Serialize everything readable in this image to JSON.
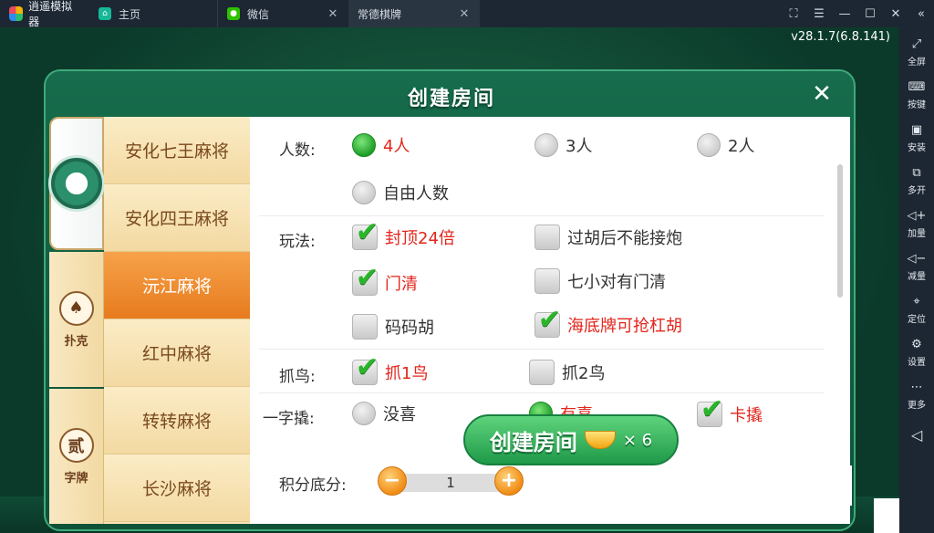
{
  "emulator": {
    "app_name": "逍遥模拟器",
    "tabs": [
      {
        "label": "主页"
      },
      {
        "label": "微信"
      },
      {
        "label": "常德棋牌"
      }
    ],
    "version": "v28.1.7(6.8.141)",
    "sidebar": [
      {
        "label": "全屏",
        "icon": "fullscreen-icon"
      },
      {
        "label": "按键",
        "icon": "keyboard-icon"
      },
      {
        "label": "安装",
        "icon": "apk-install-icon"
      },
      {
        "label": "多开",
        "icon": "multi-open-icon"
      },
      {
        "label": "加量",
        "icon": "volume-up-icon"
      },
      {
        "label": "减量",
        "icon": "volume-down-icon"
      },
      {
        "label": "定位",
        "icon": "location-icon"
      },
      {
        "label": "设置",
        "icon": "gear-icon"
      },
      {
        "label": "更多",
        "icon": "more-icon"
      }
    ]
  },
  "dialog": {
    "title": "创建房间",
    "categories": [
      {
        "label": ""
      },
      {
        "label": "扑克",
        "glyph": "♠"
      },
      {
        "label": "字牌",
        "glyph": "贰"
      }
    ],
    "games": [
      {
        "label": "安化七王麻将"
      },
      {
        "label": "安化四王麻将"
      },
      {
        "label": "沅江麻将"
      },
      {
        "label": "红中麻将"
      },
      {
        "label": "转转麻将"
      },
      {
        "label": "长沙麻将"
      }
    ],
    "players": {
      "label": "人数:",
      "options": [
        {
          "label": "4人",
          "selected": true
        },
        {
          "label": "3人",
          "selected": false
        },
        {
          "label": "2人",
          "selected": false
        },
        {
          "label": "自由人数",
          "selected": false
        }
      ]
    },
    "rules": {
      "label": "玩法:",
      "options": [
        {
          "label": "封顶24倍",
          "checked": true
        },
        {
          "label": "过胡后不能接炮",
          "checked": false
        },
        {
          "label": "门清",
          "checked": true
        },
        {
          "label": "七小对有门清",
          "checked": false
        },
        {
          "label": "码码胡",
          "checked": false
        },
        {
          "label": "海底牌可抢杠胡",
          "checked": true
        }
      ]
    },
    "birds": {
      "label": "抓鸟:",
      "options": [
        {
          "label": "抓1鸟",
          "checked": true
        },
        {
          "label": "抓2鸟",
          "checked": false
        }
      ]
    },
    "yizi": {
      "label": "一字撬:",
      "options": [
        {
          "label": "没喜",
          "selected": false
        },
        {
          "label": "有喜",
          "selected": true
        },
        {
          "label": "卡撬",
          "checked": true
        }
      ]
    },
    "score": {
      "label": "积分底分:",
      "minus": "−",
      "value": "1",
      "plus": "+"
    },
    "create": {
      "label": "创建房间",
      "cost": "× 6"
    },
    "close": "✕"
  }
}
